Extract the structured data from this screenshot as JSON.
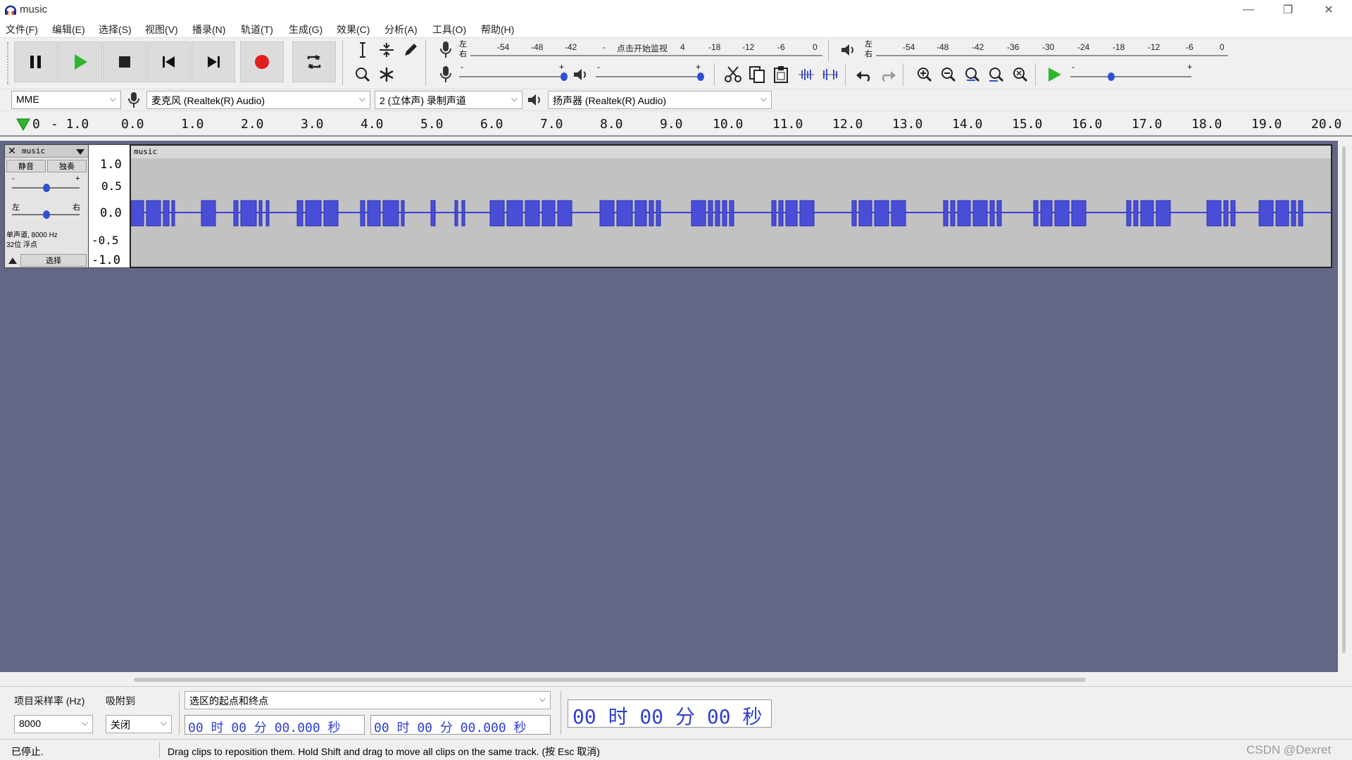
{
  "window": {
    "title": "music",
    "minimize": "—",
    "restore": "❐",
    "close": "✕"
  },
  "menu": [
    "文件(F)",
    "编辑(E)",
    "选择(S)",
    "视图(V)",
    "播录(N)",
    "轨道(T)",
    "生成(G)",
    "效果(C)",
    "分析(A)",
    "工具(O)",
    "帮助(H)"
  ],
  "transport": {
    "buttons": [
      "pause",
      "play",
      "stop",
      "skip-start",
      "skip-end",
      "record",
      "loop"
    ]
  },
  "record_meter": {
    "left_right": [
      "左",
      "右"
    ],
    "ticks": [
      "-54",
      "-48",
      "-42",
      "-",
      "点击开始监视",
      "4",
      "-18",
      "-12",
      "-6",
      "0"
    ]
  },
  "play_meter": {
    "left_right": [
      "左",
      "右"
    ],
    "ticks": [
      "-54",
      "-48",
      "-42",
      "-36",
      "-30",
      "-24",
      "-18",
      "-12",
      "-6",
      "0"
    ]
  },
  "sliders": {
    "minus": "-",
    "plus": "+"
  },
  "devices": {
    "host": "MME",
    "input": "麦克风 (Realtek(R) Audio)",
    "channels": "2 (立体声) 录制声道",
    "output": "扬声器 (Realtek(R) Audio)"
  },
  "ruler": {
    "labels": [
      "0",
      "- 1.0",
      "0.0",
      "1.0",
      "2.0",
      "3.0",
      "4.0",
      "5.0",
      "6.0",
      "7.0",
      "8.0",
      "9.0",
      "10.0",
      "11.0",
      "12.0",
      "13.0",
      "14.0",
      "15.0",
      "16.0",
      "17.0",
      "18.0",
      "19.0",
      "20.0"
    ]
  },
  "track": {
    "name": "music",
    "mute": "静音",
    "solo": "独奏",
    "gain_minus": "-",
    "gain_plus": "+",
    "pan_left": "左",
    "pan_right": "右",
    "info_line1": "单声道, 8000 Hz",
    "info_line2": "32位 浮点",
    "select": "选择",
    "clip_name": "music",
    "vruler": [
      "1.0",
      "0.5",
      "0.0",
      "-0.5",
      "-1.0"
    ]
  },
  "bottom": {
    "rate_label": "项目采样率 (Hz)",
    "rate_value": "8000",
    "snap_label": "吸附到",
    "snap_value": "关闭",
    "selection_mode": "选区的起点和终点",
    "sel_start": "00 时 00 分 00.000 秒",
    "sel_end": "00 时 00 分 00.000 秒",
    "audio_pos": "00 时 00 分 00 秒"
  },
  "status": {
    "state": "已停止.",
    "hint": "Drag clips to reposition them. Hold Shift and drag to move all clips on the same track.  (按 Esc 取消)",
    "watermark": "CSDN @Dexret"
  },
  "colors": {
    "track_bg": "#636685",
    "wave": "#3b3fd9",
    "record": "#e02020",
    "play": "#2fb52f"
  }
}
